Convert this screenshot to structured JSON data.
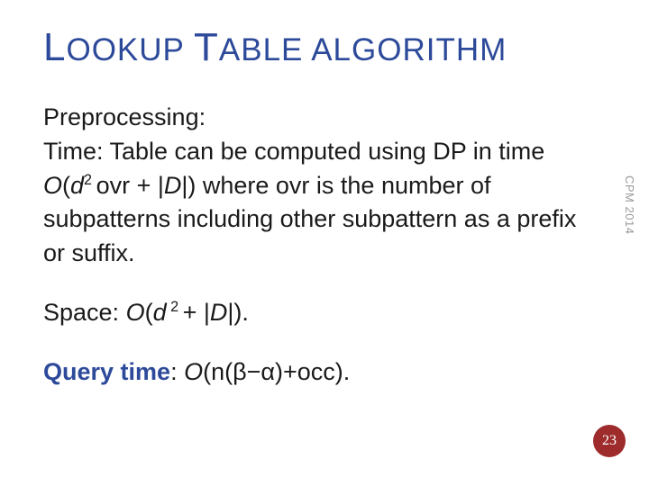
{
  "title": {
    "word1_cap": "L",
    "word1_rest": "OOKUP",
    "word2_cap": "T",
    "word2_rest": "ABLE",
    "word3": "ALGORITHM"
  },
  "para1": {
    "line1": "Preprocessing:",
    "line2_a": "Time: Table can be computed using DP in time ",
    "line2_O": "O",
    "line2_paren1": "(",
    "line2_d": "d",
    "line2_sup": "2 ",
    "line2_mid": "ovr + |",
    "line2_D": "D",
    "line2_b": "|) where ovr is the number of subpatterns including other subpattern as a prefix or suffix."
  },
  "para2": {
    "a": "Space: ",
    "O": "O",
    "paren1": "(",
    "d": "d",
    "sup": " 2 ",
    "mid": " + |",
    "D": "D",
    "b": "|)."
  },
  "para3": {
    "label": "Query time",
    "colon": ": ",
    "O": "O",
    "paren": "(n(",
    "beta": "β",
    "minus": "−",
    "alpha": "α",
    "rest": ")+occ)."
  },
  "side_label": "CPM 2014",
  "page_number": "23"
}
